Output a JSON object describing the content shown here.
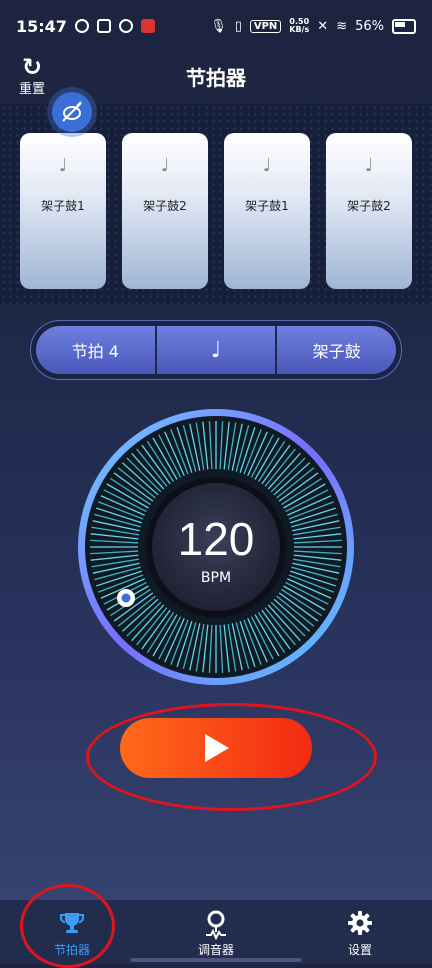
{
  "status_bar": {
    "time": "15:47",
    "network_speed_value": "0.50",
    "network_speed_unit": "KB/s",
    "vpn_label": "VPN",
    "battery": "56%"
  },
  "header": {
    "title": "节拍器",
    "reset_label": "重置"
  },
  "beats": [
    {
      "note": "♩",
      "sound": "架子鼓1"
    },
    {
      "note": "♩",
      "sound": "架子鼓2"
    },
    {
      "note": "♩",
      "sound": "架子鼓1"
    },
    {
      "note": "♩",
      "sound": "架子鼓2"
    }
  ],
  "controls": {
    "time_signature": "节拍 4",
    "note_value": "♩",
    "sound_set": "架子鼓"
  },
  "tempo": {
    "bpm": "120",
    "unit": "BPM"
  },
  "nav": {
    "items": [
      {
        "label": "节拍器",
        "icon": "trophy-icon",
        "active": true
      },
      {
        "label": "调音器",
        "icon": "tuner-pin-icon",
        "active": false
      },
      {
        "label": "设置",
        "icon": "gear-icon",
        "active": false
      }
    ]
  },
  "colors": {
    "accent": "#3c9bf5",
    "play_start": "#ff6a1a",
    "play_end": "#f32a12",
    "annotation": "#e0141e"
  }
}
